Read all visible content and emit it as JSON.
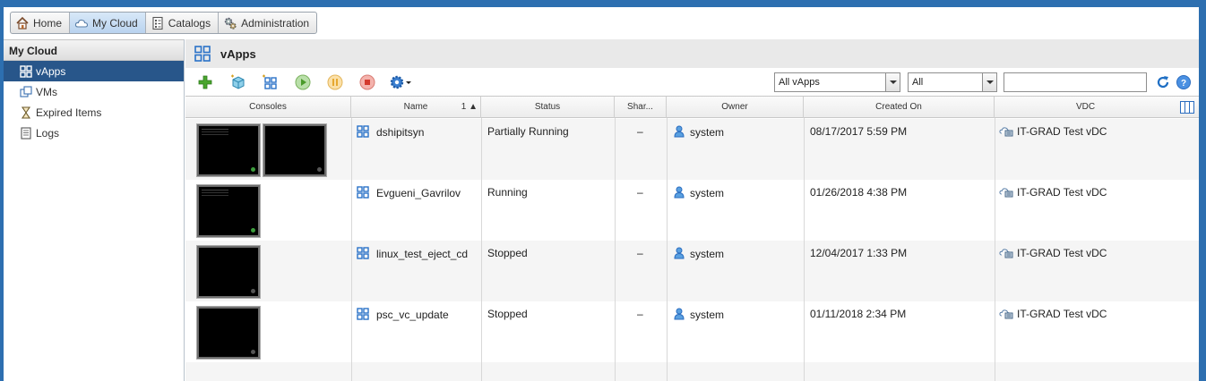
{
  "nav": {
    "tabs": [
      {
        "label": "Home",
        "icon": "home-icon"
      },
      {
        "label": "My Cloud",
        "icon": "cloud-icon",
        "active": true
      },
      {
        "label": "Catalogs",
        "icon": "catalog-icon"
      },
      {
        "label": "Administration",
        "icon": "gears-icon"
      }
    ]
  },
  "sidebar": {
    "title": "My Cloud",
    "items": [
      {
        "label": "vApps",
        "icon": "vapp-icon",
        "active": true
      },
      {
        "label": "VMs",
        "icon": "vm-icon"
      },
      {
        "label": "Expired Items",
        "icon": "hourglass-icon"
      },
      {
        "label": "Logs",
        "icon": "log-icon"
      }
    ]
  },
  "main": {
    "title": "vApps",
    "filter_primary": "All vApps",
    "filter_secondary": "All",
    "search_value": ""
  },
  "table": {
    "columns": {
      "consoles": "Consoles",
      "name": "Name",
      "sort_indicator": "1 ▲",
      "status": "Status",
      "shared": "Shar...",
      "owner": "Owner",
      "created": "Created On",
      "vdc": "VDC"
    },
    "rows": [
      {
        "name": "dshipitsyn",
        "status": "Partially Running",
        "shared": "–",
        "owner": "system",
        "created": "08/17/2017 5:59 PM",
        "vdc": "IT-GRAD Test vDC"
      },
      {
        "name": "Evgueni_Gavrilov",
        "status": "Running",
        "shared": "–",
        "owner": "system",
        "created": "01/26/2018 4:38 PM",
        "vdc": "IT-GRAD Test vDC"
      },
      {
        "name": "linux_test_eject_cd",
        "status": "Stopped",
        "shared": "–",
        "owner": "system",
        "created": "12/04/2017 1:33 PM",
        "vdc": "IT-GRAD Test vDC"
      },
      {
        "name": "psc_vc_update",
        "status": "Stopped",
        "shared": "–",
        "owner": "system",
        "created": "01/11/2018 2:34 PM",
        "vdc": "IT-GRAD Test vDC"
      }
    ]
  },
  "colors": {
    "frame": "#2d6fb0",
    "sidebar_active": "#28568a",
    "icon_blue": "#2a72c8"
  }
}
